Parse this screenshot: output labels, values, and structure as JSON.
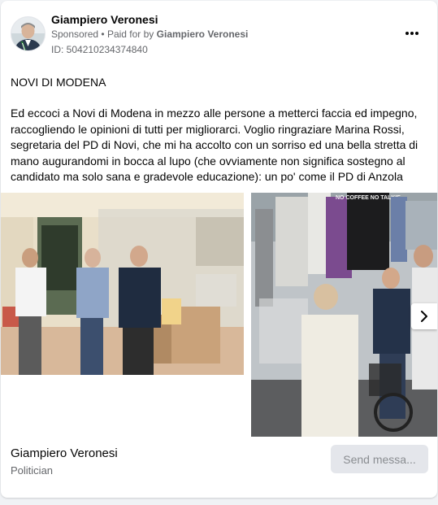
{
  "post": {
    "author": "Giampiero Veronesi",
    "sponsored_label": "Sponsored",
    "separator": "•",
    "paid_for_prefix": "Paid for by",
    "paid_for_name": "Giampiero Veronesi",
    "ad_id": "ID: 504210234374840",
    "headline": "NOVI DI MODENA",
    "body": "Ed eccoci a Novi di Modena in mezzo alle persone a metterci faccia ed impegno, raccogliendo le opinioni di tutti per migliorarci. Voglio ringraziare Marina Rossi, segretaria del PD di Novi, che mi ha accolto con un sorriso ed una bella stretta di mano augurandomi in bocca al lupo (che ovviamente non significa sostegno al candidato ma solo sana e gradevole educazione): un po' come il PD di Anzola per…"
  },
  "images": [
    {
      "name": "photo-shop-interior"
    },
    {
      "name": "photo-market-stall",
      "sign_text": "NO COFFEE NO TALKIE"
    }
  ],
  "footer": {
    "page_name": "Giampiero Veronesi",
    "category": "Politician",
    "send_button": "Send messa..."
  },
  "icons": {
    "more": "more-horizontal-icon",
    "next": "chevron-right-icon"
  },
  "colors": {
    "primary_text": "#050505",
    "secondary_text": "#65676b",
    "button_bg": "#e4e6eb",
    "button_text": "#8a8d91"
  }
}
